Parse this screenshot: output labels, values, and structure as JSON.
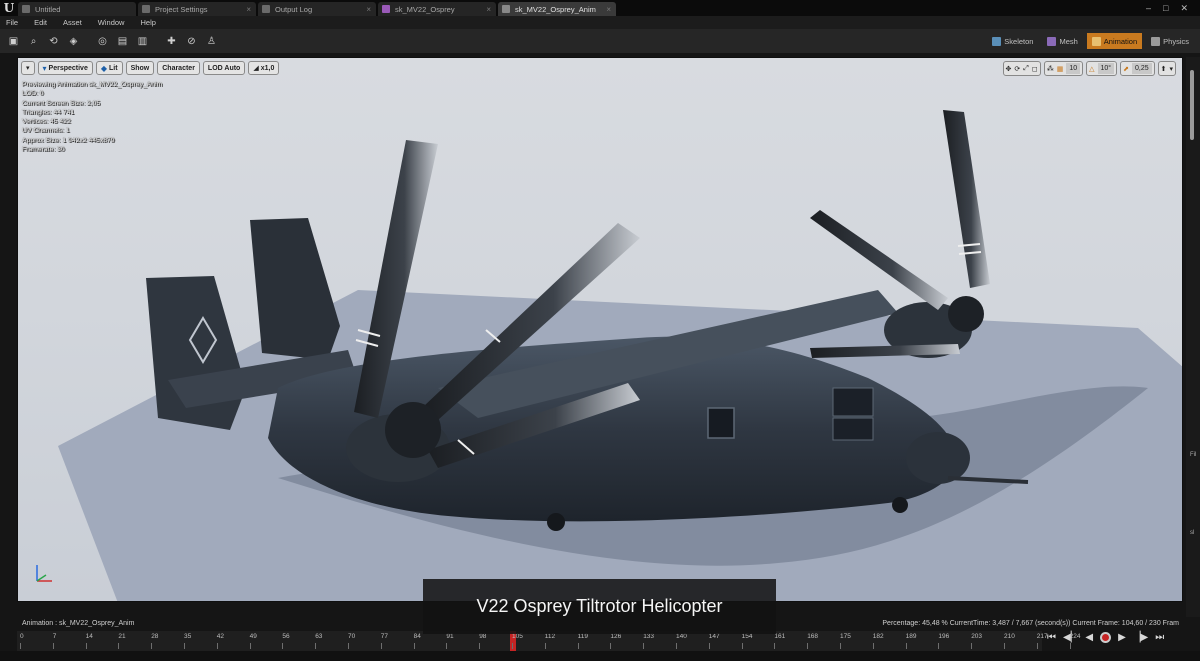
{
  "tabs": [
    {
      "label": "Untitled"
    },
    {
      "label": "Project Settings"
    },
    {
      "label": "Output Log"
    },
    {
      "label": "sk_MV22_Osprey"
    },
    {
      "label": "sk_MV22_Osprey_Anim"
    }
  ],
  "window_controls": {
    "minimize": "–",
    "maximize": "□",
    "close": "✕"
  },
  "menu": {
    "file": "File",
    "edit": "Edit",
    "asset": "Asset",
    "window": "Window",
    "help": "Help"
  },
  "modes": {
    "skeleton": "Skeleton",
    "mesh": "Mesh",
    "animation": "Animation",
    "physics": "Physics"
  },
  "viewport_toolbar": {
    "perspective": "Perspective",
    "lit": "Lit",
    "show": "Show",
    "character": "Character",
    "lod": "LOD Auto",
    "speed": "x1,0"
  },
  "viewport_right": {
    "grid_snap": "10",
    "rotation_snap": "10°",
    "scale_snap": "0,25"
  },
  "stats": {
    "previewing": "Previewing Animation sk_MV22_Osprey_Anim",
    "lod": "LOD: 0",
    "screen_size": "Current Screen Size: 2,05",
    "triangles": "Triangles: 44 741",
    "vertices": "Vertices: 45 422",
    "uv_channels": "UV Channels: 1",
    "approx_size": "Approx Size: 1 942x2 445x879",
    "framerate": "Framerate: 30"
  },
  "caption": "V22 Osprey Tiltrotor Helicopter",
  "anim_bar": {
    "name": "Animation : sk_MV22_Osprey_Anim",
    "stats": "Percentage:  45,48 % CurrentTime:  3,487 / 7,667 (second(s)) Current Frame:  104,60 / 230 Fram"
  },
  "timeline": {
    "ticks": [
      "0",
      "7",
      "14",
      "21",
      "28",
      "35",
      "42",
      "49",
      "56",
      "63",
      "70",
      "77",
      "84",
      "91",
      "98",
      "105",
      "112",
      "119",
      "126",
      "133",
      "140",
      "147",
      "154",
      "161",
      "168",
      "175",
      "182",
      "189",
      "196",
      "203",
      "210",
      "217",
      "224"
    ],
    "current_frame": 104.6,
    "total_frames": 230
  },
  "colors": {
    "accent": "#c97a1f",
    "playhead": "#c62424",
    "viewport_bg": "#d4d8de",
    "floor": "#9ea7ba"
  }
}
